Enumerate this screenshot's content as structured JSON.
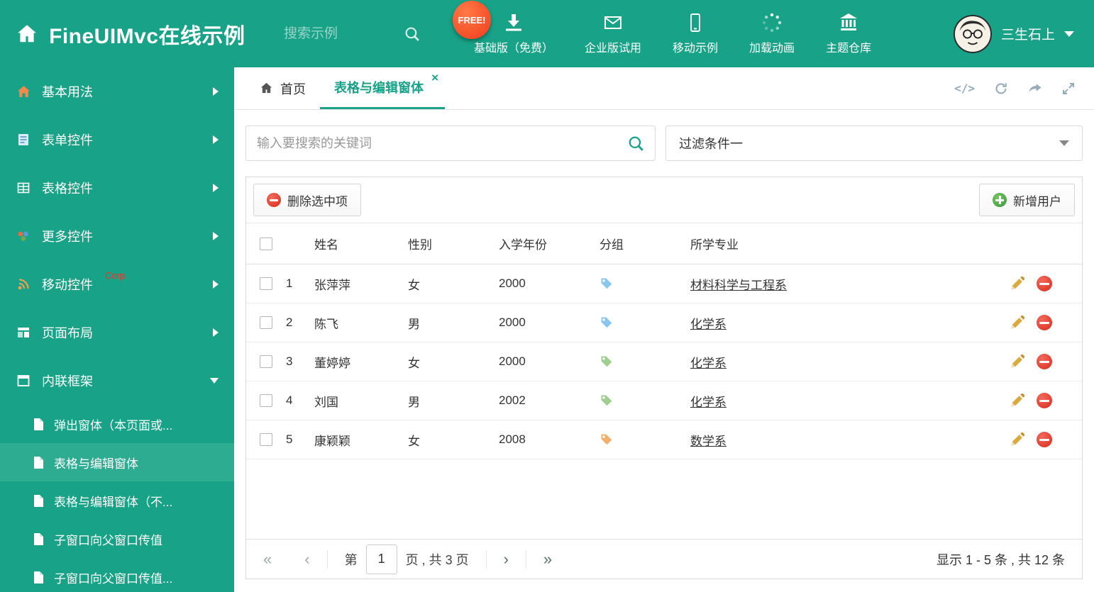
{
  "header": {
    "brand": "FineUIMvc在线示例",
    "search_placeholder": "搜索示例",
    "free_badge": "FREE!",
    "nav_items": [
      {
        "label": "基础版（免费）",
        "icon": "download-icon"
      },
      {
        "label": "企业版试用",
        "icon": "envelope-icon"
      },
      {
        "label": "移动示例",
        "icon": "mobile-icon"
      },
      {
        "label": "加载动画",
        "icon": "spinner-icon"
      },
      {
        "label": "主题仓库",
        "icon": "bank-icon"
      }
    ],
    "username": "三生石上"
  },
  "sidebar": {
    "items": [
      {
        "label": "基本用法"
      },
      {
        "label": "表单控件"
      },
      {
        "label": "表格控件"
      },
      {
        "label": "更多控件"
      },
      {
        "label": "移动控件",
        "badge": "Corp."
      },
      {
        "label": "页面布局"
      },
      {
        "label": "内联框架"
      }
    ],
    "subitems": [
      {
        "label": "弹出窗体（本页面或..."
      },
      {
        "label": "表格与编辑窗体"
      },
      {
        "label": "表格与编辑窗体（不..."
      },
      {
        "label": "子窗口向父窗口传值"
      },
      {
        "label": "子窗口向父窗口传值..."
      }
    ]
  },
  "tabs": {
    "home_label": "首页",
    "active_label": "表格与编辑窗体"
  },
  "filter": {
    "search_placeholder": "输入要搜索的关键词",
    "dropdown_value": "过滤条件一"
  },
  "toolbar": {
    "delete_label": "删除选中项",
    "add_label": "新增用户"
  },
  "table": {
    "columns": {
      "name": "姓名",
      "gender": "性别",
      "year": "入学年份",
      "group": "分组",
      "major": "所学专业"
    },
    "rows": [
      {
        "index": "1",
        "name": "张萍萍",
        "gender": "女",
        "year": "2000",
        "tag_color": "#8AC6EE",
        "major": "材料科学与工程系"
      },
      {
        "index": "2",
        "name": "陈飞",
        "gender": "男",
        "year": "2000",
        "tag_color": "#8AC6EE",
        "major": "化学系"
      },
      {
        "index": "3",
        "name": "董婷婷",
        "gender": "女",
        "year": "2000",
        "tag_color": "#9FCE8F",
        "major": "化学系"
      },
      {
        "index": "4",
        "name": "刘国",
        "gender": "男",
        "year": "2002",
        "tag_color": "#9FCE8F",
        "major": "化学系"
      },
      {
        "index": "5",
        "name": "康颖颖",
        "gender": "女",
        "year": "2008",
        "tag_color": "#F2B06E",
        "major": "数学系"
      }
    ]
  },
  "pagination": {
    "label_page": "第",
    "page_value": "1",
    "label_total": "页 , 共 3 页",
    "summary": "显示 1 - 5 条 , 共 12 条"
  },
  "colors": {
    "primary": "#18A287",
    "sidebar_active": "#2EAC92",
    "free_badge": "#F23B1C",
    "delete_red": "#D92B1C",
    "add_green": "#3D9A3C",
    "pencil_gold": "#DCA93C"
  }
}
